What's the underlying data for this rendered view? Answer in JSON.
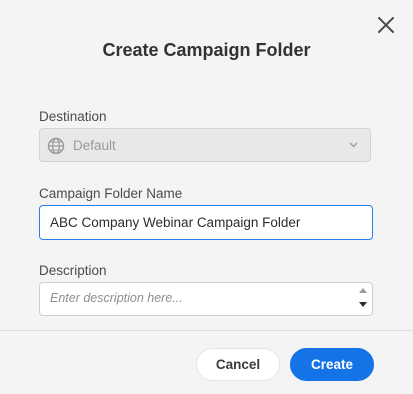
{
  "dialog": {
    "title": "Create Campaign Folder",
    "close_icon": "close-icon"
  },
  "destination": {
    "label": "Destination",
    "value": "Default",
    "icon": "globe-icon",
    "disabled": true
  },
  "folder_name": {
    "label": "Campaign Folder Name",
    "value": "ABC Company Webinar Campaign Folder"
  },
  "description": {
    "label": "Description",
    "placeholder": "Enter description here..."
  },
  "footer": {
    "cancel_label": "Cancel",
    "create_label": "Create"
  },
  "colors": {
    "accent": "#1473e6",
    "focus_border": "#2680eb",
    "background": "#f4f4f4"
  }
}
